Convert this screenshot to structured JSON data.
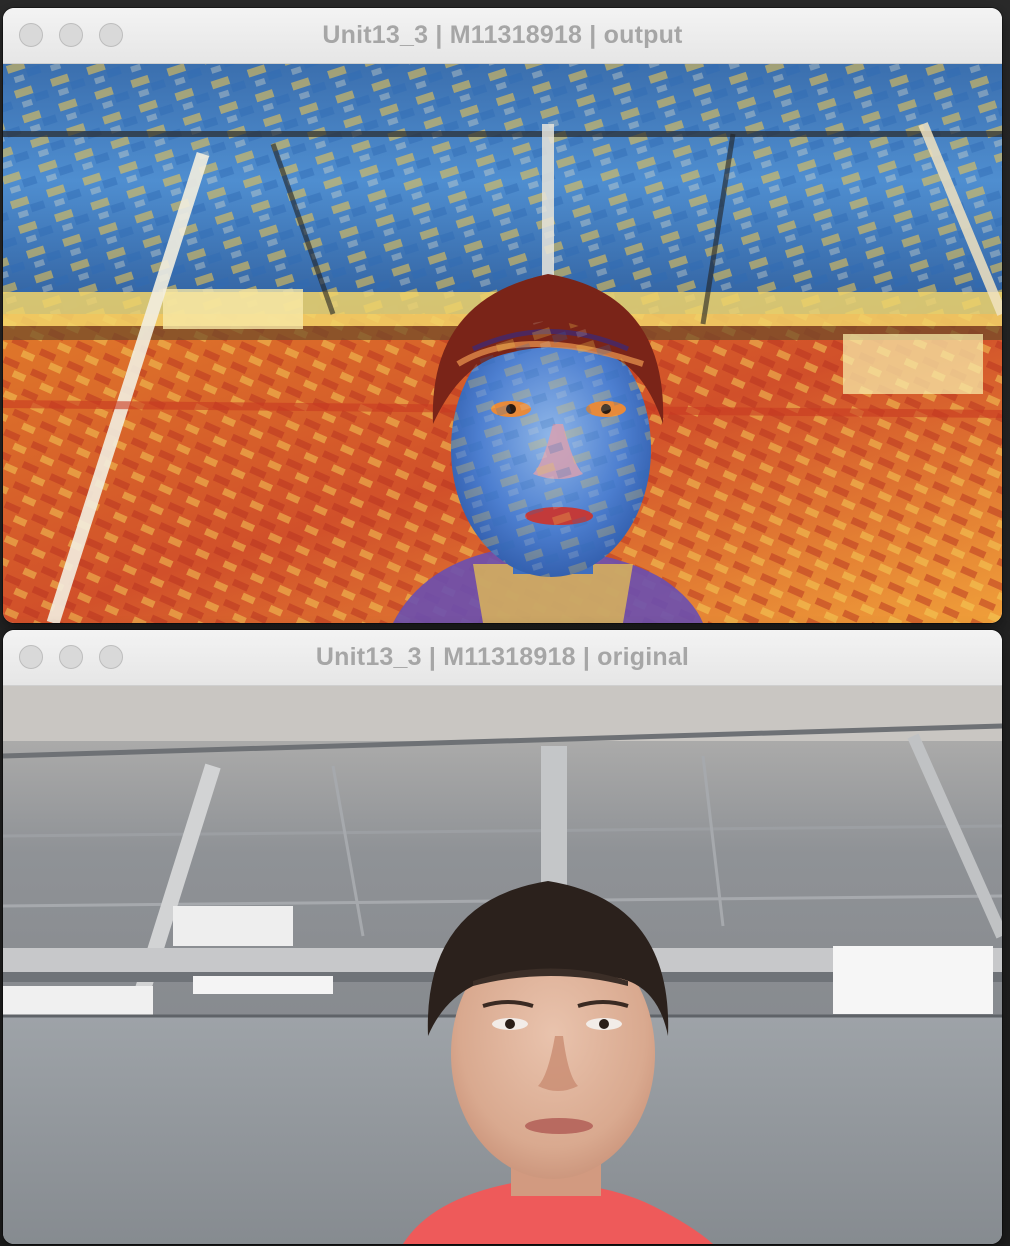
{
  "windows": {
    "output": {
      "title": "Unit13_3 | M11318918 | output",
      "content": "stylized-webcam-frame"
    },
    "original": {
      "title": "Unit13_3 | M11318918 | original",
      "content": "webcam-frame"
    }
  },
  "colors": {
    "titlebar": "#ececec",
    "title_text": "#a6a6a6",
    "traffic_light": "#d9d9d9",
    "ceiling_gray": "#9a9da0",
    "painted_orange": "#d9622a",
    "painted_blue": "#3f7fc4",
    "face_painted": "#4f7fd0",
    "shirt_pink": "#ee5a5a"
  }
}
